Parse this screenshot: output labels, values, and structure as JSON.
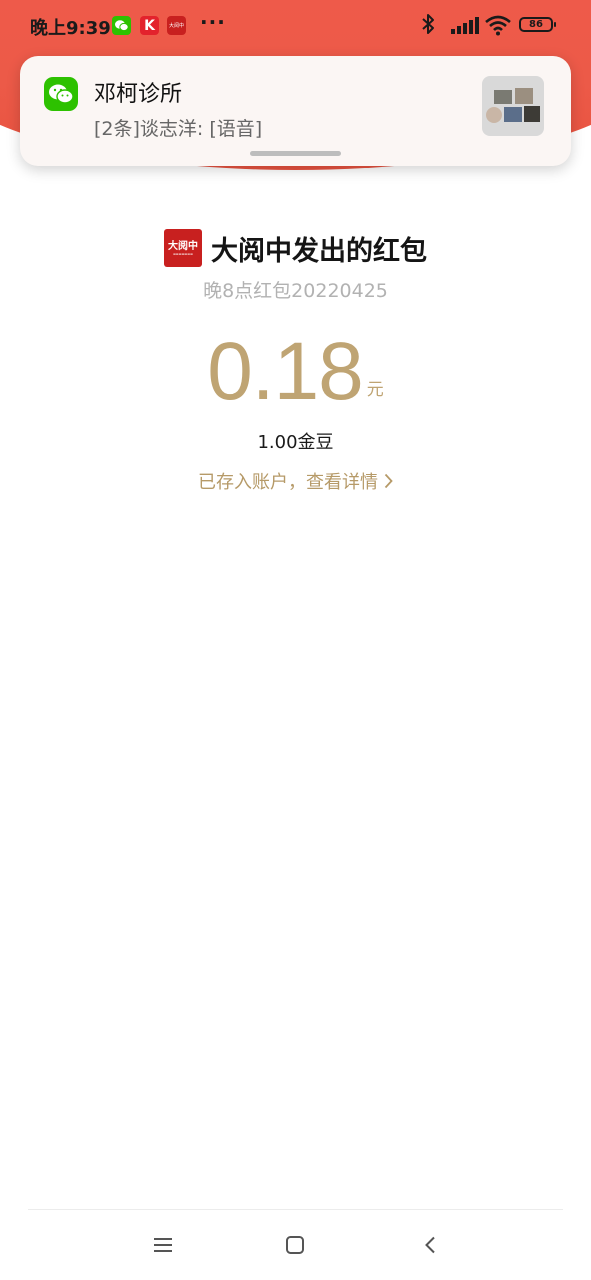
{
  "status_bar": {
    "time": "晚上9:39",
    "battery": "86",
    "k_app_glyph": "K",
    "dyz_app_text": "大阅中",
    "more": "···",
    "icons": [
      "wechat-icon",
      "k-app-icon",
      "dayuezhong-app-icon",
      "bluetooth-icon",
      "signal-icon",
      "wifi-icon",
      "battery-icon"
    ]
  },
  "notification": {
    "app": "wechat",
    "title": "邓柯诊所",
    "message": "[2条]谈志洋: [语音]"
  },
  "red_packet": {
    "logo_text": "大阅中",
    "sender": "大阅中发出的红包",
    "subtitle": "晚8点红包20220425",
    "amount": "0.18",
    "unit": "元",
    "beans": "1.00金豆",
    "details_link": "已存入账户，查看详情"
  },
  "nav_bar": {
    "buttons": [
      "menu",
      "home",
      "back"
    ]
  },
  "colors": {
    "header_red": "#ec5a48",
    "amount_gold": "#bfa473",
    "link_gold": "#b69a68",
    "wechat_green": "#2dc100",
    "brand_red": "#c8201f"
  }
}
